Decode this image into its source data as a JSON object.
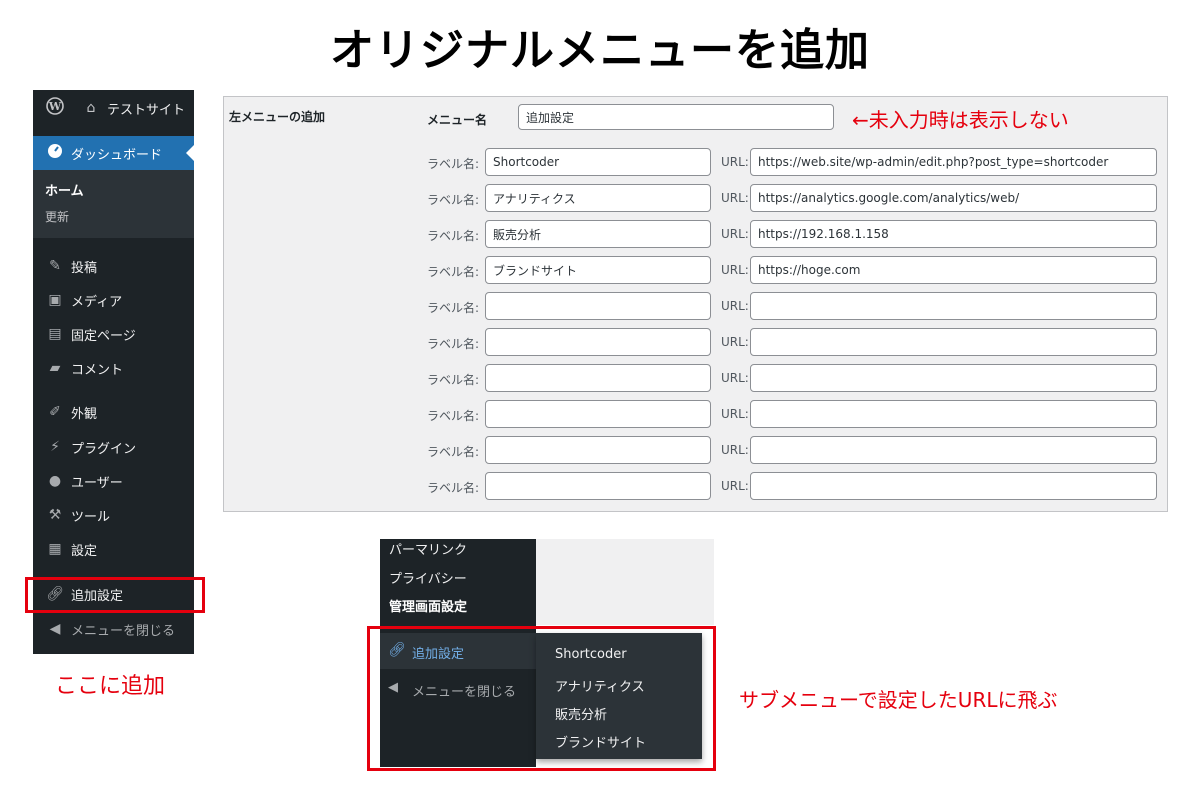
{
  "title": "オリジナルメニューを追加",
  "sidebar": {
    "site_name": "テストサイト",
    "dashboard": "ダッシュボード",
    "sub_home": "ホーム",
    "sub_update": "更新",
    "items": [
      {
        "label": "投稿",
        "icon": "pushpin-icon"
      },
      {
        "label": "メディア",
        "icon": "media-icon"
      },
      {
        "label": "固定ページ",
        "icon": "page-icon"
      },
      {
        "label": "コメント",
        "icon": "comment-icon"
      },
      {
        "label": "外観",
        "icon": "brush-icon"
      },
      {
        "label": "プラグイン",
        "icon": "plug-icon"
      },
      {
        "label": "ユーザー",
        "icon": "user-icon"
      },
      {
        "label": "ツール",
        "icon": "wrench-icon"
      },
      {
        "label": "設定",
        "icon": "settings-icon"
      }
    ],
    "added": "追加設定",
    "close": "メニューを閉じる"
  },
  "callouts": {
    "here": "ここに追加",
    "unset_note": "←未入力時は表示しない",
    "submenu_note": "サブメニューで設定したURLに飛ぶ"
  },
  "form": {
    "section_label": "左メニューの追加",
    "menu_name_label": "メニュー名",
    "menu_name_value": "追加設定",
    "label_caption": "ラベル名:",
    "url_caption": "URL:",
    "rows": [
      {
        "label": "Shortcoder",
        "url": "https://web.site/wp-admin/edit.php?post_type=shortcoder"
      },
      {
        "label": "アナリティクス",
        "url": "https://analytics.google.com/analytics/web/"
      },
      {
        "label": "販売分析",
        "url": "https://192.168.1.158"
      },
      {
        "label": "ブランドサイト",
        "url": "https://hoge.com"
      },
      {
        "label": "",
        "url": ""
      },
      {
        "label": "",
        "url": ""
      },
      {
        "label": "",
        "url": ""
      },
      {
        "label": "",
        "url": ""
      },
      {
        "label": "",
        "url": ""
      },
      {
        "label": "",
        "url": ""
      }
    ]
  },
  "preview": {
    "permalink": "パーマリンク",
    "privacy": "プライバシー",
    "admin_settings": "管理画面設定",
    "active": "追加設定",
    "close": "メニューを閉じる",
    "flyout": [
      "Shortcoder",
      "アナリティクス",
      "販売分析",
      "ブランドサイト"
    ]
  },
  "colors": {
    "accent": "#2271b1",
    "sidebar_bg": "#1d2327",
    "annotation_red": "#e5000e",
    "link_blue": "#72aee6"
  }
}
